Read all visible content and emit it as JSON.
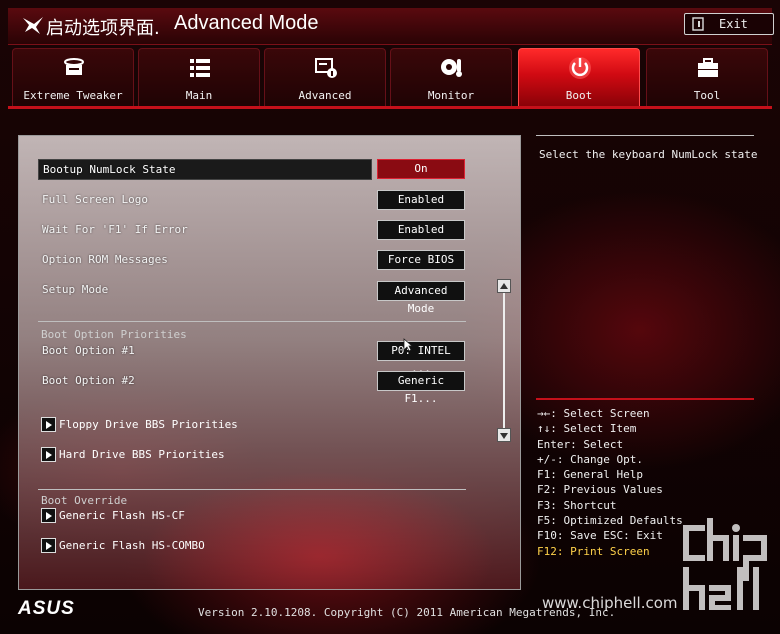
{
  "header": {
    "title_cn": "启动选项界面.",
    "title_mode": "Advanced Mode",
    "exit_label": "Exit"
  },
  "tabs": [
    {
      "label": "Extreme Tweaker",
      "icon": "extreme-tweaker-icon",
      "active": false
    },
    {
      "label": "Main",
      "icon": "list-icon",
      "active": false
    },
    {
      "label": "Advanced",
      "icon": "advanced-settings-icon",
      "active": false
    },
    {
      "label": "Monitor",
      "icon": "thermometer-fan-icon",
      "active": false
    },
    {
      "label": "Boot",
      "icon": "power-icon",
      "active": true
    },
    {
      "label": "Tool",
      "icon": "toolbox-icon",
      "active": false
    }
  ],
  "settings": [
    {
      "label": "Bootup NumLock State",
      "value": "On",
      "selected": true
    },
    {
      "label": "Full Screen Logo",
      "value": "Enabled"
    },
    {
      "label": "Wait For 'F1' If Error",
      "value": "Enabled"
    },
    {
      "label": "Option ROM Messages",
      "value": "Force BIOS"
    },
    {
      "label": "Setup Mode",
      "value": "Advanced Mode"
    }
  ],
  "boot_priorities": {
    "section_title": "Boot Option Priorities",
    "options": [
      {
        "label": "Boot Option #1",
        "value": "P0: INTEL ..."
      },
      {
        "label": "Boot Option #2",
        "value": "Generic F1..."
      }
    ],
    "submenus": [
      "Floppy Drive BBS Priorities",
      "Hard Drive BBS Priorities"
    ]
  },
  "boot_override": {
    "section_title": "Boot Override",
    "items": [
      "Generic Flash HS-CF",
      "Generic Flash HS-COMBO"
    ]
  },
  "help": {
    "description": "Select the keyboard NumLock state",
    "keys": [
      "→←: Select Screen",
      "↑↓: Select Item",
      "Enter: Select",
      "+/-: Change Opt.",
      "F1: General Help",
      "F2: Previous Values",
      "F3: Shortcut",
      "F5: Optimized Defaults",
      "F10: Save  ESC: Exit",
      "F12: Print Screen"
    ],
    "highlight_color": "#ffd24a"
  },
  "footer": {
    "brand": "ASUS",
    "version": "Version 2.10.1208. Copyright (C) 2011 American Megatrends, Inc.",
    "watermark_url": "www.chiphell.com"
  },
  "colors": {
    "accent": "#c5101a",
    "active_tab": "#e0141c",
    "selected_value": "#8a0b12"
  }
}
